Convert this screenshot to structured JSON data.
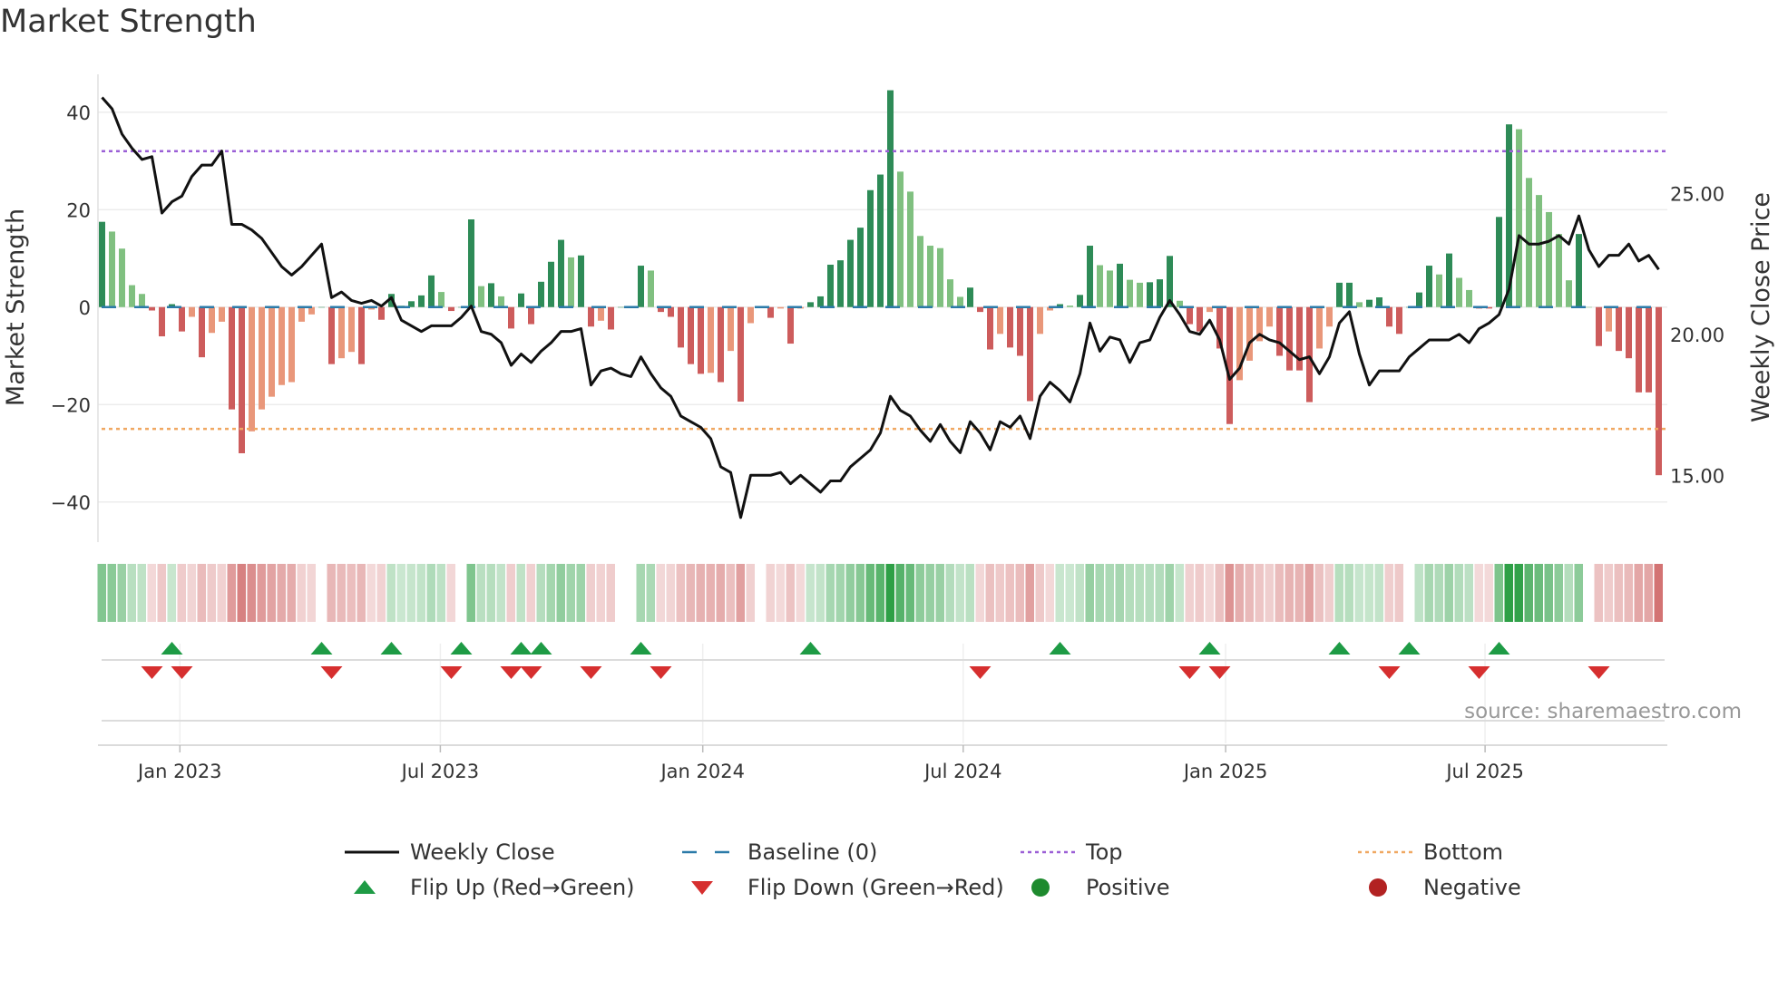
{
  "title": "Market Strength",
  "source": "source: sharemaestro.com",
  "colors": {
    "pos_strong": "#2e8b57",
    "pos_weak": "#80c080",
    "neg_strong": "#cd5c5c",
    "neg_weak": "#e9977a",
    "price": "#111111",
    "baseline": "#2b7aa8",
    "top": "#9b5fd6",
    "bottom": "#f0a862",
    "flip_up": "#1e9b45",
    "flip_down": "#d62f2f",
    "positive": "#1e8a2e",
    "negative": "#b22222"
  },
  "chart_data": {
    "type": "bar+line",
    "title": "Market Strength",
    "ylabel": "Market Strength",
    "y2label": "Weekly Close Price",
    "ylim": [
      -48,
      48
    ],
    "y2lim": [
      13,
      28.7
    ],
    "yticks": [
      -40,
      -20,
      0,
      20,
      40
    ],
    "yticklabels": [
      "−40",
      "−20",
      "0",
      "20",
      "40"
    ],
    "y2ticks": [
      15,
      20,
      25
    ],
    "y2ticklabels": [
      "15.00",
      "20.00",
      "25.00"
    ],
    "xlim": [
      0.5,
      158
    ],
    "xticks": [
      {
        "week": 8.8,
        "label": "Jan 2023"
      },
      {
        "week": 34.9,
        "label": "Jul 2023"
      },
      {
        "week": 61.2,
        "label": "Jan 2024"
      },
      {
        "week": 87.3,
        "label": "Jul 2024"
      },
      {
        "week": 113.6,
        "label": "Jan 2025"
      },
      {
        "week": 139.6,
        "label": "Jul 2025"
      }
    ],
    "top_threshold": 32,
    "bottom_threshold": -25,
    "baseline": 0,
    "strength": [
      17.5,
      15.5,
      12,
      4.5,
      2.7,
      -0.7,
      -6,
      0.6,
      -5,
      -2,
      -10.3,
      -5.3,
      -3,
      -21,
      -30,
      -25.5,
      -21,
      -18.4,
      -16,
      -15.4,
      -3,
      -1.5,
      0,
      -11.7,
      -10.5,
      -9.2,
      -11.7,
      -0.5,
      -2.6,
      2.7,
      0.3,
      1.2,
      2.4,
      6.5,
      3.1,
      -0.8,
      0,
      18,
      4.3,
      4.9,
      2.2,
      -4.4,
      2.8,
      -3.5,
      5.2,
      9.3,
      13.8,
      10.2,
      10.6,
      -4,
      -2.8,
      -4.6,
      0,
      0,
      8.5,
      7.5,
      -1,
      -2,
      -8.3,
      -11.7,
      -13.7,
      -13.5,
      -15.4,
      -9,
      -19.4,
      -3.3,
      0,
      -2.2,
      -0.3,
      -7.5,
      -0.3,
      1,
      2.2,
      8.7,
      9.6,
      13.8,
      16.3,
      24,
      27.2,
      44.5,
      27.8,
      23.7,
      14.6,
      12.6,
      12.1,
      5.7,
      2.1,
      4,
      -1,
      -8.7,
      -5.5,
      -8.3,
      -10,
      -19.3,
      -5.5,
      -0.7,
      0.6,
      0.3,
      2.5,
      12.6,
      8.6,
      7.5,
      8.9,
      5.6,
      5,
      5.1,
      5.7,
      10.5,
      1.3,
      -3.5,
      -5,
      -1,
      -8.5,
      -24,
      -15,
      -11,
      -7,
      -4,
      -10,
      -13,
      -13,
      -19.5,
      -8.5,
      -4,
      5,
      5,
      1,
      1.5,
      2,
      -4,
      -5.5,
      0,
      3,
      8.5,
      6.7,
      11,
      6,
      3.5,
      -0.3,
      -0.3,
      18.5,
      37.5,
      36.5,
      26.5,
      23,
      19.5,
      15,
      5.5,
      15,
      0,
      -8,
      -5,
      -9,
      -10.5,
      -17.5,
      -17.5,
      -34.5
    ],
    "price": [
      28.4,
      28.0,
      27.1,
      26.6,
      26.2,
      26.3,
      24.3,
      24.7,
      24.9,
      25.6,
      26.0,
      26.0,
      26.5,
      23.9,
      23.9,
      23.7,
      23.4,
      22.9,
      22.4,
      22.1,
      22.4,
      22.8,
      23.2,
      21.3,
      21.5,
      21.2,
      21.1,
      21.2,
      21.0,
      21.3,
      20.5,
      20.3,
      20.1,
      20.3,
      20.3,
      20.3,
      20.6,
      21.0,
      20.1,
      20.0,
      19.7,
      18.9,
      19.3,
      19.0,
      19.4,
      19.7,
      20.1,
      20.1,
      20.2,
      18.2,
      18.7,
      18.8,
      18.6,
      18.5,
      19.2,
      18.6,
      18.1,
      17.8,
      17.1,
      16.9,
      16.7,
      16.3,
      15.3,
      15.1,
      13.5,
      15.0,
      15.0,
      15.0,
      15.1,
      14.7,
      15.0,
      14.7,
      14.4,
      14.8,
      14.8,
      15.3,
      15.6,
      15.9,
      16.5,
      17.8,
      17.3,
      17.1,
      16.6,
      16.2,
      16.8,
      16.2,
      15.8,
      16.9,
      16.5,
      15.9,
      16.9,
      16.7,
      17.1,
      16.3,
      17.8,
      18.3,
      18.0,
      17.6,
      18.6,
      20.4,
      19.4,
      19.9,
      19.8,
      19.0,
      19.7,
      19.8,
      20.6,
      21.2,
      20.7,
      20.1,
      20.0,
      20.5,
      19.8,
      18.4,
      18.8,
      19.7,
      20.0,
      19.8,
      19.7,
      19.4,
      19.1,
      19.2,
      18.6,
      19.2,
      20.4,
      20.8,
      19.3,
      18.2,
      18.7,
      18.7,
      18.7,
      19.2,
      19.5,
      19.8,
      19.8,
      19.8,
      20.0,
      19.7,
      20.2,
      20.4,
      20.7,
      21.6,
      23.5,
      23.2,
      23.2,
      23.3,
      23.5,
      23.2,
      24.2,
      23.0,
      22.4,
      22.8,
      22.8,
      23.2,
      22.6,
      22.8,
      22.3
    ],
    "flip_up_weeks": [
      8,
      23,
      30,
      37,
      43,
      45,
      55,
      72,
      97,
      112,
      125,
      132,
      141
    ],
    "flip_down_weeks": [
      6,
      9,
      24,
      36,
      42,
      44,
      50,
      57,
      89,
      110,
      113,
      130,
      139,
      151
    ]
  },
  "legend": [
    {
      "key": "weekly-close",
      "label": "Weekly Close"
    },
    {
      "key": "baseline",
      "label": "Baseline (0)"
    },
    {
      "key": "top",
      "label": "Top"
    },
    {
      "key": "bottom",
      "label": "Bottom"
    },
    {
      "key": "flip-up",
      "label": "Flip Up (Red→Green)"
    },
    {
      "key": "flip-down",
      "label": "Flip Down (Green→Red)"
    },
    {
      "key": "positive",
      "label": "Positive"
    },
    {
      "key": "negative",
      "label": "Negative"
    }
  ]
}
